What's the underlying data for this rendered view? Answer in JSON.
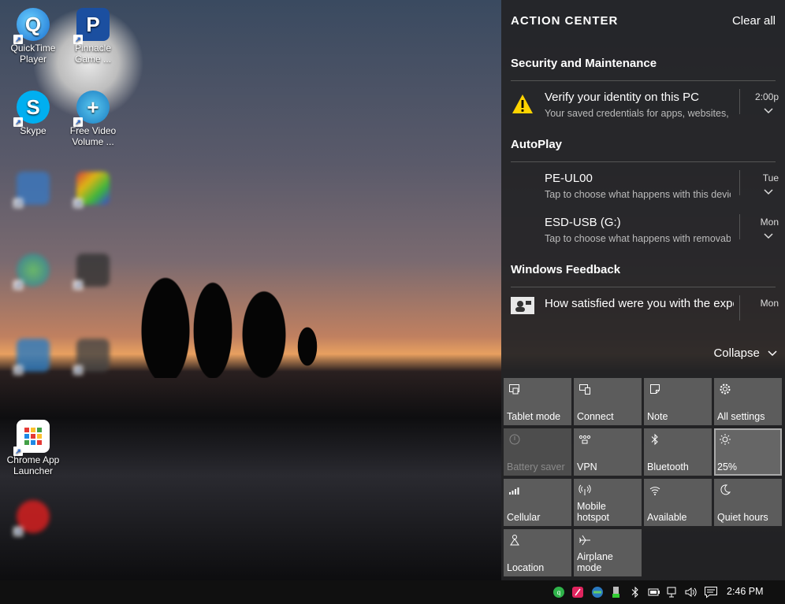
{
  "desktop": {
    "icons": [
      {
        "label": "QuickTime Player"
      },
      {
        "label": "Pinnacle Game ..."
      },
      {
        "label": "Skype"
      },
      {
        "label": "Free Video Volume ..."
      },
      {
        "label": "Chrome App Launcher"
      }
    ]
  },
  "action_center": {
    "title": "ACTION CENTER",
    "clear_all": "Clear all",
    "groups": [
      {
        "title": "Security and Maintenance",
        "notifications": [
          {
            "title": "Verify your identity on this PC",
            "body": "Your saved credentials for apps, websites, and networks",
            "time": "2:00p",
            "icon": "warning-icon"
          }
        ]
      },
      {
        "title": "AutoPlay",
        "notifications": [
          {
            "title": "PE-UL00",
            "body": "Tap to choose what happens with this device.",
            "time": "Tue"
          },
          {
            "title": "ESD-USB (G:)",
            "body": "Tap to choose what happens with removable drives.",
            "time": "Mon"
          }
        ]
      },
      {
        "title": "Windows Feedback",
        "notifications": [
          {
            "title": "How satisfied were you with the experience?",
            "time": "Mon",
            "icon": "feedback-icon"
          }
        ]
      }
    ],
    "collapse": "Collapse",
    "quick_actions": [
      {
        "label": "Tablet mode",
        "icon": "tablet-mode-icon"
      },
      {
        "label": "Connect",
        "icon": "connect-icon"
      },
      {
        "label": "Note",
        "icon": "note-icon"
      },
      {
        "label": "All settings",
        "icon": "gear-icon"
      },
      {
        "label": "Battery saver",
        "icon": "battery-saver-icon",
        "state": "disabled"
      },
      {
        "label": "VPN",
        "icon": "vpn-icon"
      },
      {
        "label": "Bluetooth",
        "icon": "bluetooth-icon"
      },
      {
        "label": "25%",
        "icon": "brightness-icon",
        "state": "active"
      },
      {
        "label": "Cellular",
        "icon": "cellular-icon"
      },
      {
        "label": "Mobile hotspot",
        "icon": "mobile-hotspot-icon"
      },
      {
        "label": "Available",
        "icon": "wifi-icon"
      },
      {
        "label": "Quiet hours",
        "icon": "moon-icon"
      },
      {
        "label": "Location",
        "icon": "location-icon"
      },
      {
        "label": "Airplane mode",
        "icon": "airplane-icon"
      }
    ]
  },
  "taskbar": {
    "clock": "2:46 PM",
    "tray_icons": [
      "app-green-icon",
      "app-red-icon",
      "app-network-icon",
      "usb-icon",
      "bluetooth-icon",
      "battery-icon",
      "network-icon",
      "volume-icon",
      "action-center-icon"
    ]
  }
}
